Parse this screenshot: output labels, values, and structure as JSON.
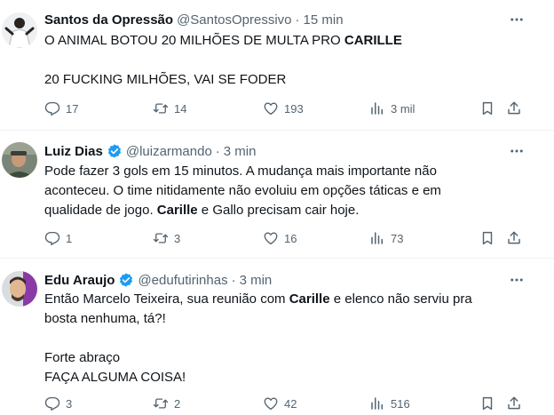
{
  "tweets": [
    {
      "name": "Santos da Opressão",
      "verified": false,
      "handle": "@SantosOpressivo",
      "time": "15 min",
      "body": {
        "l1a": "O ANIMAL BOTOU 20 MILHÕES DE MULTA PRO ",
        "l1b": "CARILLE",
        "l3": "20 FUCKING MILHÕES, VAI SE FODER"
      },
      "replies": "17",
      "retweets": "14",
      "likes": "193",
      "views": "3 mil"
    },
    {
      "name": "Luiz Dias",
      "verified": true,
      "handle": "@luizarmando",
      "time": "3 min",
      "body": {
        "l1": "Pode fazer 3 gols em 15 minutos. A mudança mais importante não",
        "l2": "aconteceu. O time nitidamente não evoluiu em opções táticas e em",
        "l3a": "qualidade de jogo. ",
        "l3b": "Carille",
        "l3c": " e Gallo precisam cair hoje."
      },
      "replies": "1",
      "retweets": "3",
      "likes": "16",
      "views": "73"
    },
    {
      "name": "Edu Araujo",
      "verified": true,
      "handle": "@edufutirinhas",
      "time": "3 min",
      "body": {
        "l1a": "Então Marcelo Teixeira, sua reunião com ",
        "l1b": "Carille",
        "l1c": " e elenco não serviu pra",
        "l2": "bosta nenhuma, tá?!",
        "l4": "Forte abraço",
        "l5": "FAÇA ALGUMA COISA!"
      },
      "replies": "3",
      "retweets": "2",
      "likes": "42",
      "views": "516"
    }
  ],
  "colors": {
    "text": "#0f1419",
    "secondary": "#536471",
    "verified": "#1d9bf0",
    "divider": "#eff3f4"
  },
  "icons": [
    "reply-icon",
    "retweet-icon",
    "like-icon",
    "views-icon",
    "bookmark-icon",
    "share-icon",
    "more-icon",
    "verified-badge-icon"
  ]
}
